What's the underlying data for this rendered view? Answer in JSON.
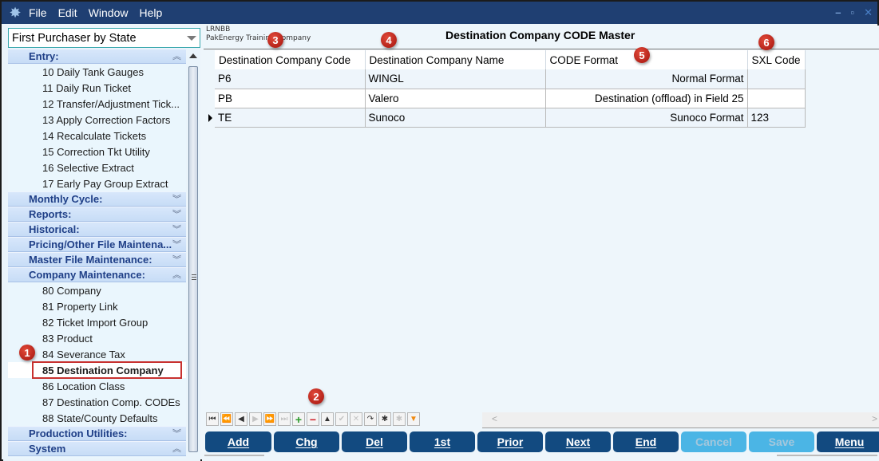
{
  "menubar": {
    "logo_icon": "app-star-icon",
    "items": [
      "File",
      "Edit",
      "Window",
      "Help"
    ],
    "window_controls": {
      "minimize": "–",
      "restore": "▫",
      "close": "✕"
    }
  },
  "sidebar": {
    "combo_value": "First Purchaser by State",
    "groups": [
      {
        "label": "Entry:",
        "expanded": true,
        "chevron": "⌃",
        "items": [
          "10 Daily Tank Gauges",
          "11 Daily Run Ticket",
          "12 Transfer/Adjustment Tick...",
          "13 Apply Correction Factors",
          "14 Recalculate Tickets",
          "15 Correction Tkt Utility",
          "16 Selective Extract",
          "17 Early Pay Group Extract"
        ]
      },
      {
        "label": "Monthly Cycle:",
        "expanded": false
      },
      {
        "label": "Reports:",
        "expanded": false
      },
      {
        "label": "Historical:",
        "expanded": false
      },
      {
        "label": "Pricing/Other File Maintena...",
        "expanded": false
      },
      {
        "label": "Master File Maintenance:",
        "expanded": false
      },
      {
        "label": "Company Maintenance:",
        "expanded": true,
        "items": [
          "80 Company",
          "81 Property Link",
          "82 Ticket Import Group",
          "83 Product",
          "84 Severance Tax",
          "85 Destination Company",
          "86 Location Class",
          "87 Destination Comp. CODEs",
          "88 State/County Defaults"
        ],
        "selected": "85 Destination Company"
      },
      {
        "label": "Production Utilities:",
        "expanded": false
      },
      {
        "label": "System",
        "expanded": true
      }
    ]
  },
  "header": {
    "company_code": "LRNBB",
    "company_name": "PakEnergy Training Company",
    "title": "Destination Company CODE Master"
  },
  "grid": {
    "columns": [
      "Destination Company Code",
      "Destination Company Name",
      "CODE Format",
      "SXL Code"
    ],
    "rows": [
      {
        "code": "P6",
        "name": "WINGL",
        "format": "Normal Format",
        "sxl": ""
      },
      {
        "code": "PB",
        "name": "Valero",
        "format": "Destination (offload) in Field 25",
        "sxl": ""
      },
      {
        "code": "TE",
        "name": "Sunoco",
        "format": "Sunoco Format",
        "sxl": "123",
        "current": true
      }
    ]
  },
  "navigator": {
    "buttons": [
      {
        "name": "first-record",
        "glyph": "⏮",
        "enabled": true
      },
      {
        "name": "prior-page",
        "glyph": "⏪",
        "enabled": true
      },
      {
        "name": "prior-record",
        "glyph": "◀",
        "enabled": true
      },
      {
        "name": "next-record",
        "glyph": "▶",
        "enabled": false
      },
      {
        "name": "next-page",
        "glyph": "⏩",
        "enabled": false
      },
      {
        "name": "last-record",
        "glyph": "⏭",
        "enabled": false
      },
      {
        "name": "insert",
        "glyph": "+",
        "enabled": true
      },
      {
        "name": "delete",
        "glyph": "−",
        "enabled": true
      },
      {
        "name": "edit",
        "glyph": "▲",
        "enabled": true
      },
      {
        "name": "post",
        "glyph": "✔",
        "enabled": false
      },
      {
        "name": "cancel-edit",
        "glyph": "✕",
        "enabled": false
      },
      {
        "name": "refresh",
        "glyph": "↷",
        "enabled": true
      },
      {
        "name": "apply-update",
        "glyph": "✱",
        "enabled": true
      },
      {
        "name": "cancel-update",
        "glyph": "✱",
        "enabled": false
      },
      {
        "name": "filter",
        "glyph": "▼",
        "enabled": true
      }
    ],
    "scroll_left": "<",
    "scroll_right": ">"
  },
  "actions": [
    {
      "label": "Add",
      "enabled": true
    },
    {
      "label": "Chg",
      "enabled": true
    },
    {
      "label": "Del",
      "enabled": true
    },
    {
      "label": "1st",
      "enabled": true
    },
    {
      "label": "Prior",
      "enabled": true
    },
    {
      "label": "Next",
      "enabled": true
    },
    {
      "label": "End",
      "enabled": true
    },
    {
      "label": "Cancel",
      "enabled": false
    },
    {
      "label": "Save",
      "enabled": false
    },
    {
      "label": "Menu",
      "enabled": true
    }
  ],
  "annotations": [
    "1",
    "2",
    "3",
    "4",
    "5",
    "6"
  ],
  "colors": {
    "titlebar": "#1f3f72",
    "button": "#124a80",
    "button_disabled": "#4bb5e5",
    "group_header_text": "#1f3f87",
    "highlight_box": "#c8312f",
    "badge": "#c0281e"
  }
}
